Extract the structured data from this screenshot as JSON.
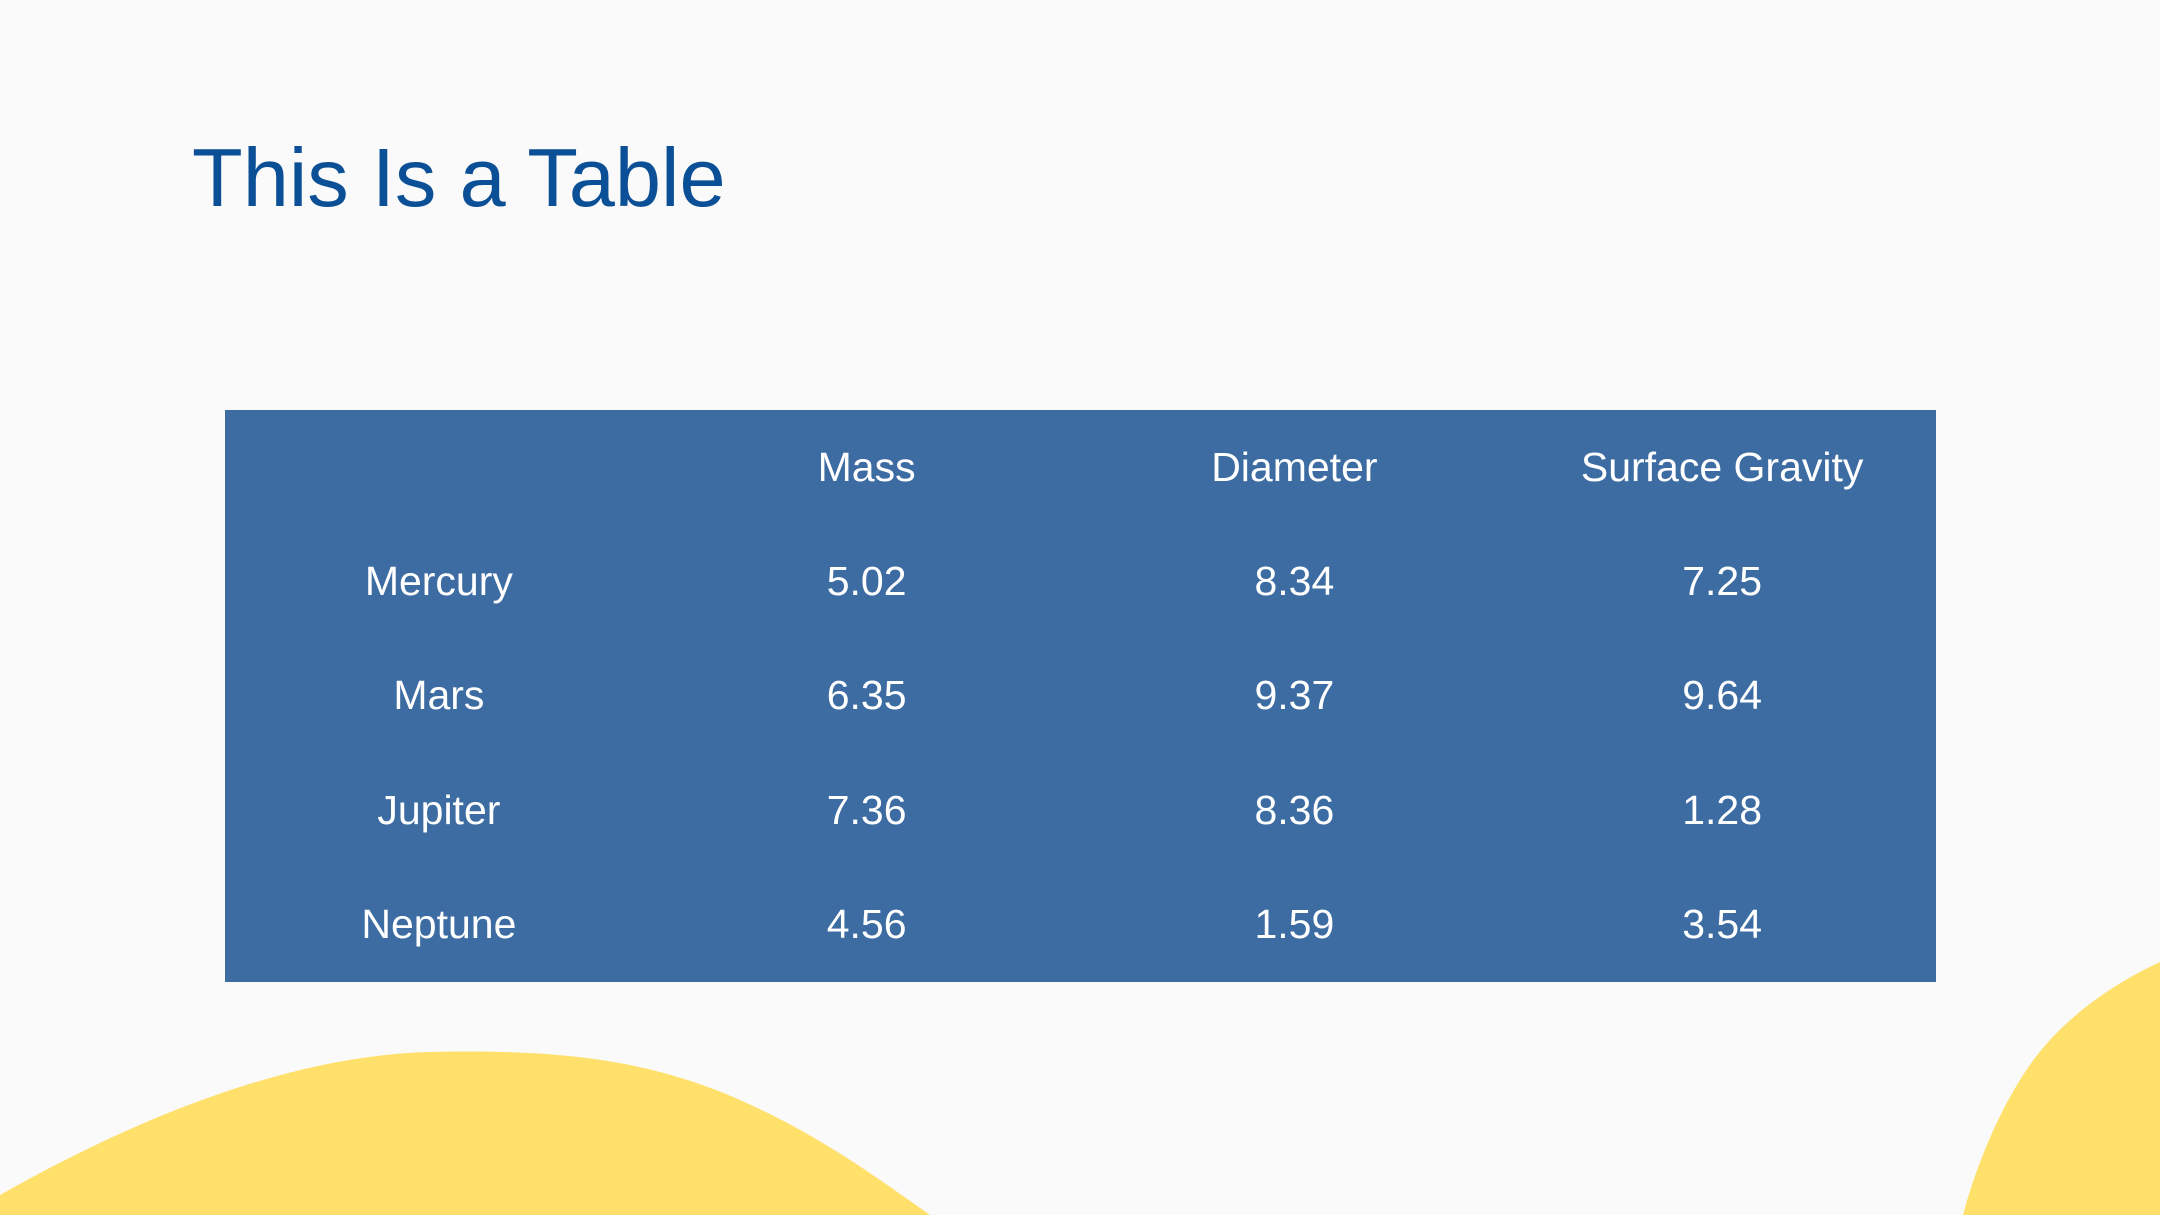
{
  "slide": {
    "title": "This Is a Table"
  },
  "table": {
    "headers": [
      "",
      "Mass",
      "Diameter",
      "Surface Gravity"
    ],
    "rows": [
      [
        "Mercury",
        "5.02",
        "8.34",
        "7.25"
      ],
      [
        "Mars",
        "6.35",
        "9.37",
        "9.64"
      ],
      [
        "Jupiter",
        "7.36",
        "8.36",
        "1.28"
      ],
      [
        "Neptune",
        "4.56",
        "1.59",
        "3.54"
      ]
    ]
  },
  "colors": {
    "background": "#fafafa",
    "title": "#0b4f96",
    "table_fill": "#3d6ca3",
    "table_text": "#ffffff",
    "accent_wave": "#ffe06b"
  }
}
